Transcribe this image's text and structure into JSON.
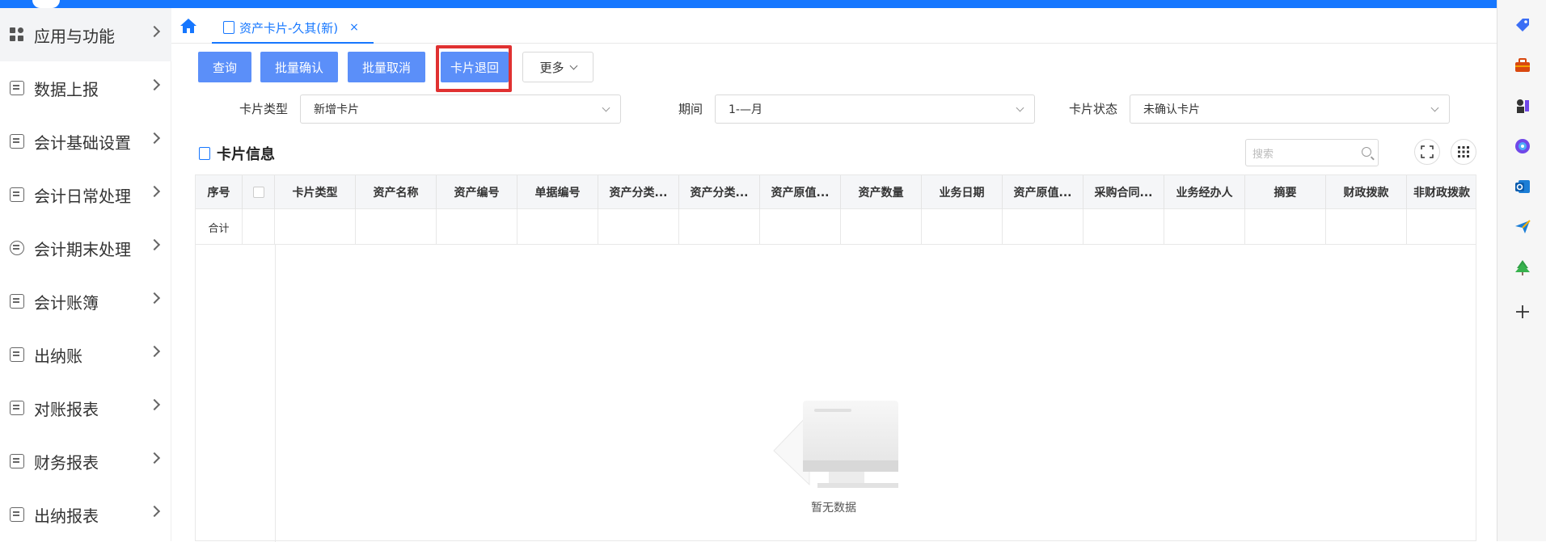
{
  "sidebar": {
    "items": [
      {
        "label": "应用与功能",
        "icon": "apps-grid-icon"
      },
      {
        "label": "数据上报",
        "icon": "report-upload-icon"
      },
      {
        "label": "会计基础设置",
        "icon": "settings-doc-icon"
      },
      {
        "label": "会计日常处理",
        "icon": "daily-process-icon"
      },
      {
        "label": "会计期末处理",
        "icon": "period-end-icon"
      },
      {
        "label": "会计账簿",
        "icon": "ledger-icon"
      },
      {
        "label": "出纳账",
        "icon": "cashier-book-icon"
      },
      {
        "label": "对账报表",
        "icon": "reconciliation-icon"
      },
      {
        "label": "财务报表",
        "icon": "finance-report-icon"
      },
      {
        "label": "出纳报表",
        "icon": "cashier-report-icon"
      }
    ]
  },
  "tabs": {
    "home_icon": "home-icon",
    "active_tab": {
      "label": "资产卡片-久其(新)",
      "close": "×"
    }
  },
  "toolbar": {
    "query": "查询",
    "batch_confirm": "批量确认",
    "batch_cancel": "批量取消",
    "card_return": "卡片退回",
    "more": "更多"
  },
  "filters": {
    "card_type": {
      "label": "卡片类型",
      "value": "新增卡片"
    },
    "period": {
      "label": "期间",
      "value": "1-—月"
    },
    "card_status": {
      "label": "卡片状态",
      "value": "未确认卡片"
    }
  },
  "section": {
    "title": "卡片信息",
    "search_placeholder": "搜索"
  },
  "table": {
    "columns": [
      "序号",
      "",
      "卡片类型",
      "资产名称",
      "资产编号",
      "单据编号",
      "资产分类...",
      "资产分类...",
      "资产原值...",
      "资产数量",
      "业务日期",
      "资产原值...",
      "采购合同...",
      "业务经办人",
      "摘要",
      "财政拨款",
      "非财政拨款"
    ],
    "summary_label": "合计",
    "empty_text": "暂无数据"
  },
  "colors": {
    "accent": "#1677ff",
    "button": "#5b8ff9",
    "highlight": "#e03131"
  },
  "rail_icons": [
    "tag-icon",
    "briefcase-icon",
    "chess-icon",
    "copilot-icon",
    "outlook-icon",
    "send-icon",
    "tree-icon",
    "plus-icon"
  ]
}
